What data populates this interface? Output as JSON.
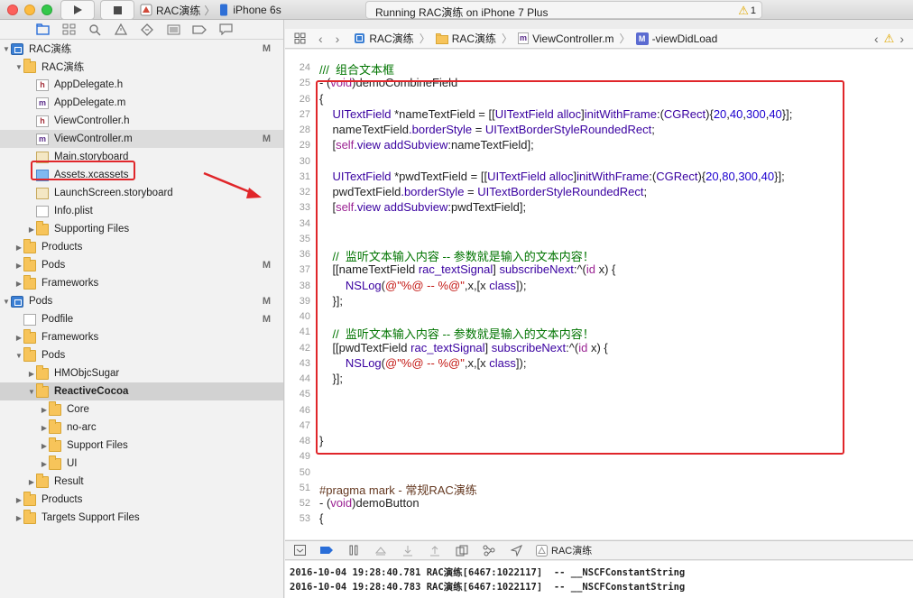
{
  "titlebar": {
    "scheme_project": "RAC演练",
    "scheme_device": "iPhone 6s",
    "status": "Running RAC演练 on iPhone 7 Plus",
    "warning_count": "1",
    "run_icon": "play-icon",
    "stop_icon": "stop-icon"
  },
  "navigator_icons": [
    "folder-icon",
    "hierarchy-icon",
    "search-icon",
    "warning-icon",
    "test-diamond-icon",
    "debug-list-icon",
    "breakpoint-icon",
    "report-icon"
  ],
  "tree": [
    {
      "label": "RAC演练",
      "badge": "M",
      "type": "project"
    },
    {
      "label": "RAC演练",
      "badge": "",
      "type": "folder"
    },
    {
      "label": "AppDelegate.h",
      "badge": "",
      "type": "h"
    },
    {
      "label": "AppDelegate.m",
      "badge": "",
      "type": "m"
    },
    {
      "label": "ViewController.h",
      "badge": "",
      "type": "h"
    },
    {
      "label": "ViewController.m",
      "badge": "M",
      "type": "m"
    },
    {
      "label": "Main.storyboard",
      "badge": "",
      "type": "storyboard"
    },
    {
      "label": "Assets.xcassets",
      "badge": "",
      "type": "xcassets"
    },
    {
      "label": "LaunchScreen.storyboard",
      "badge": "",
      "type": "storyboard"
    },
    {
      "label": "Info.plist",
      "badge": "",
      "type": "plist"
    },
    {
      "label": "Supporting Files",
      "badge": "",
      "type": "folder"
    },
    {
      "label": "Products",
      "badge": "",
      "type": "folder"
    },
    {
      "label": "Pods",
      "badge": "M",
      "type": "folder"
    },
    {
      "label": "Frameworks",
      "badge": "",
      "type": "folder"
    },
    {
      "label": "Pods",
      "badge": "M",
      "type": "project"
    },
    {
      "label": "Podfile",
      "badge": "M",
      "type": "plist"
    },
    {
      "label": "Frameworks",
      "badge": "",
      "type": "folder"
    },
    {
      "label": "Pods",
      "badge": "",
      "type": "folder"
    },
    {
      "label": "HMObjcSugar",
      "badge": "",
      "type": "folder"
    },
    {
      "label": "ReactiveCocoa",
      "badge": "",
      "type": "folder"
    },
    {
      "label": "Core",
      "badge": "",
      "type": "folder"
    },
    {
      "label": "no-arc",
      "badge": "",
      "type": "folder"
    },
    {
      "label": "Support Files",
      "badge": "",
      "type": "folder"
    },
    {
      "label": "UI",
      "badge": "",
      "type": "folder"
    },
    {
      "label": "Result",
      "badge": "",
      "type": "folder"
    },
    {
      "label": "Products",
      "badge": "",
      "type": "folder"
    },
    {
      "label": "Targets Support Files",
      "badge": "",
      "type": "folder"
    }
  ],
  "jumpbar": {
    "project": "RAC演练",
    "group": "RAC演练",
    "file": "ViewController.m",
    "symbol_badge": "M",
    "symbol": "-viewDidLoad"
  },
  "editor": {
    "lines": [
      {
        "num": "24",
        "text": "///  组合文本框"
      },
      {
        "num": "25",
        "text": "- (void)demoCombineField"
      },
      {
        "num": "26",
        "text": "{"
      },
      {
        "num": "27",
        "text": "    UITextField *nameTextField = [[UITextField alloc]initWithFrame:(CGRect){20,40,300,40}];"
      },
      {
        "num": "28",
        "text": "    nameTextField.borderStyle = UITextBorderStyleRoundedRect;"
      },
      {
        "num": "29",
        "text": "    [self.view addSubview:nameTextField];"
      },
      {
        "num": "30",
        "text": ""
      },
      {
        "num": "31",
        "text": "    UITextField *pwdTextField = [[UITextField alloc]initWithFrame:(CGRect){20,80,300,40}];"
      },
      {
        "num": "32",
        "text": "    pwdTextField.borderStyle = UITextBorderStyleRoundedRect;"
      },
      {
        "num": "33",
        "text": "    [self.view addSubview:pwdTextField];"
      },
      {
        "num": "34",
        "text": ""
      },
      {
        "num": "35",
        "text": ""
      },
      {
        "num": "36",
        "text": "    //  监听文本输入内容 -- 参数就是输入的文本内容！"
      },
      {
        "num": "37",
        "text": "    [[nameTextField rac_textSignal] subscribeNext:^(id x) {"
      },
      {
        "num": "38",
        "text": "        NSLog(@\"%@ -- %@\",x,[x class]);"
      },
      {
        "num": "39",
        "text": "    }];"
      },
      {
        "num": "40",
        "text": ""
      },
      {
        "num": "41",
        "text": "    //  监听文本输入内容 -- 参数就是输入的文本内容！"
      },
      {
        "num": "42",
        "text": "    [[pwdTextField rac_textSignal] subscribeNext:^(id x) {"
      },
      {
        "num": "43",
        "text": "        NSLog(@\"%@ -- %@\",x,[x class]);"
      },
      {
        "num": "44",
        "text": "    }];"
      },
      {
        "num": "45",
        "text": ""
      },
      {
        "num": "46",
        "text": ""
      },
      {
        "num": "47",
        "text": ""
      },
      {
        "num": "48",
        "text": "}"
      },
      {
        "num": "49",
        "text": ""
      },
      {
        "num": "50",
        "text": ""
      },
      {
        "num": "51",
        "text": "#pragma mark - 常规RAC演练"
      },
      {
        "num": "52",
        "text": "- (void)demoButton"
      },
      {
        "num": "53",
        "text": "{"
      }
    ]
  },
  "debugbar": {
    "target": "RAC演练"
  },
  "console": {
    "lines": [
      "2016-10-04 19:28:40.781 RAC演练[6467:1022117]  -- __NSCFConstantString",
      "2016-10-04 19:28:40.783 RAC演练[6467:1022117]  -- __NSCFConstantString"
    ]
  }
}
